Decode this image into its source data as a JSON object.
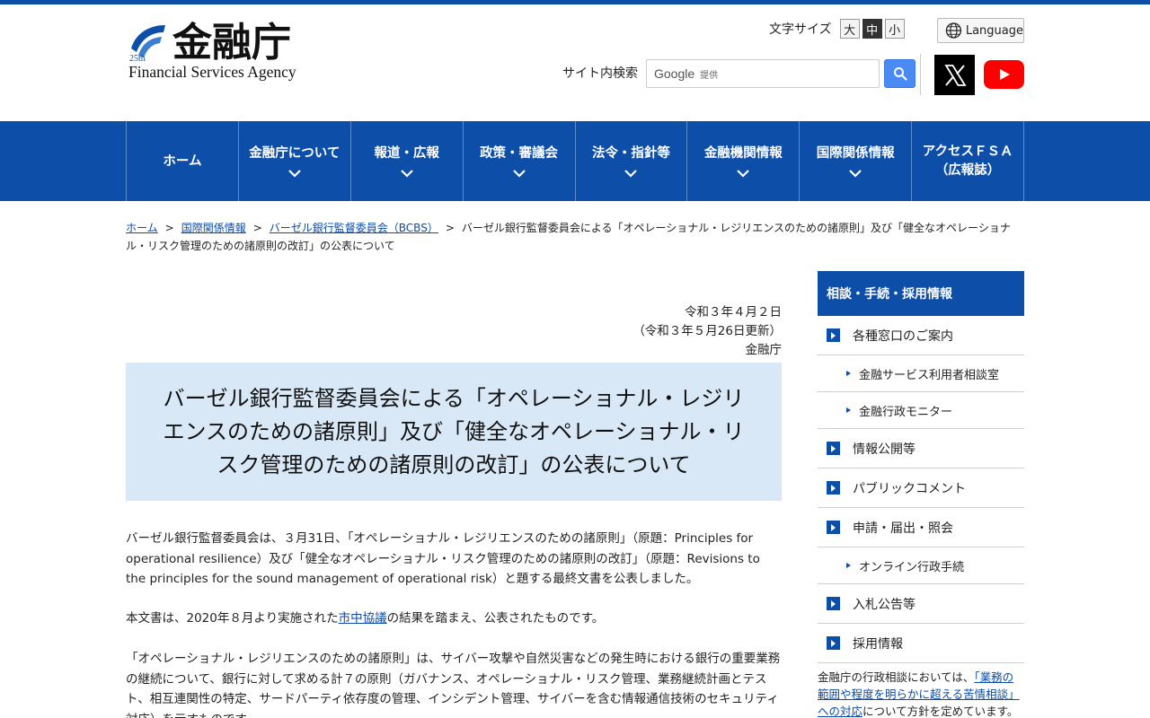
{
  "header": {
    "logo_kanji": "金融庁",
    "logo_en": "Financial Services Agency",
    "fontsize_label": "文字サイズ",
    "fontsize_options": [
      "大",
      "中",
      "小"
    ],
    "language_label": "Language",
    "search_label": "サイト内検索",
    "search_google": "Google",
    "search_provided": "提供"
  },
  "nav": {
    "items": [
      {
        "label": "ホーム"
      },
      {
        "label": "金融庁について"
      },
      {
        "label": "報道・広報"
      },
      {
        "label": "政策・審議会"
      },
      {
        "label": "法令・指針等"
      },
      {
        "label": "金融機関情報"
      },
      {
        "label": "国際関係情報"
      },
      {
        "label": "アクセスＦＳＡ",
        "label2": "（広報誌）"
      }
    ]
  },
  "breadcrumb": {
    "home": "ホーム",
    "intl": "国際関係情報",
    "bcbs": "バーゼル銀行監督委員会（BCBS）",
    "current": "バーゼル銀行監督委員会による「オペレーショナル・レジリエンスのための諸原則」及び「健全なオペレーショナル・リスク管理のための諸原則の改訂」の公表について"
  },
  "main": {
    "date": "令和３年４月２日",
    "updated": "（令和３年５月26日更新）",
    "issuer": "金融庁",
    "title": "バーゼル銀行監督委員会による「オペレーショナル・レジリエンスのための諸原則」及び「健全なオペレーショナル・リスク管理のための諸原則の改訂」の公表について",
    "para1": "バーゼル銀行監督委員会は、３月31日、「オペレーショナル・レジリエンスのための諸原則」（原題：Principles for operational resilience）及び「健全なオペレーショナル・リスク管理のための諸原則の改訂」（原題：Revisions to the principles for the sound management of operational risk）と題する最終文書を公表しました。",
    "para2_before": "本文書は、2020年８月より実施された",
    "para2_link": "市中協議",
    "para2_after": "の結果を踏まえ、公表されたものです。",
    "para3": "「オペレーショナル・レジリエンスのための諸原則」は、サイバー攻撃や自然災害などの発生時における銀行の重要業務の継続について、銀行に対して求める計７の原則（ガバナンス、オペレーショナル・リスク管理、業務継続計画とテスト、相互連関性の特定、サードパーティ依存度の管理、インシデント管理、サイバーを含む情報通信技術のセキュリティ対応）を示すものです。"
  },
  "sidebar": {
    "heading": "相談・手続・採用情報",
    "items": [
      {
        "label": "各種窓口のご案内"
      },
      {
        "label": "金融サービス利用者相談室"
      },
      {
        "label": "金融行政モニター"
      },
      {
        "label": "情報公開等"
      },
      {
        "label": "パブリックコメント"
      },
      {
        "label": "申請・届出・照会"
      },
      {
        "label": "オンライン行政手続"
      },
      {
        "label": "入札公告等"
      },
      {
        "label": "採用情報"
      }
    ],
    "note_before": "金融庁の行政相談においては、",
    "note_link": "「業務の範囲や程度を明らかに超える苦情相談」への対応",
    "note_after": "について方針を定めています。"
  },
  "colors": {
    "brand": "#0d4ea8",
    "title_bg": "#d9e8f6",
    "search_button": "#4a8af4",
    "youtube": "#ff0000"
  }
}
